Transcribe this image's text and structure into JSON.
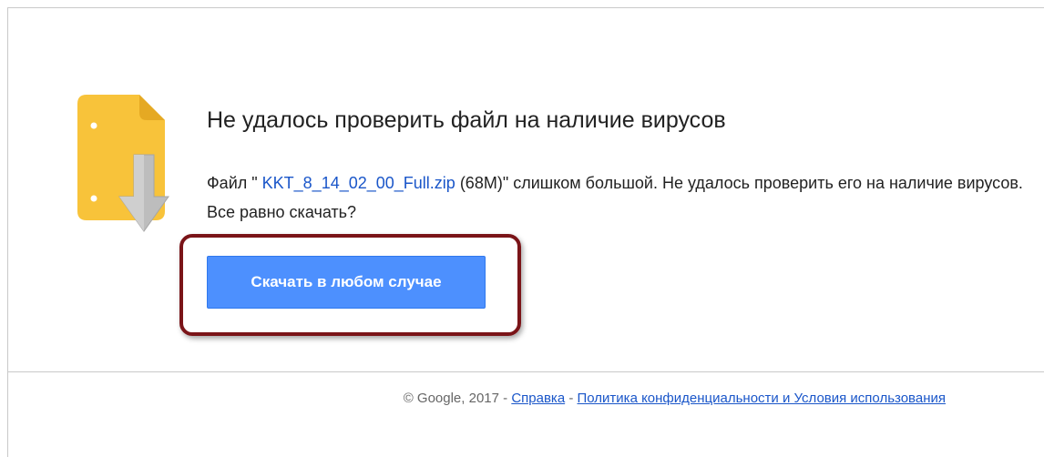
{
  "icon": {
    "name": "file-download-icon",
    "colors": {
      "file": "#f8c33a",
      "file_fold": "#e5a923",
      "arrow": "#b8b8b8"
    }
  },
  "warning": {
    "title": "Не удалось проверить файл на наличие вирусов",
    "message_prefix": "Файл \" ",
    "file_name": "KKT_8_14_02_00_Full.zip",
    "message_suffix": " (68M)\" слишком большой. Не удалось проверить его на наличие вирусов. Все равно скачать?"
  },
  "actions": {
    "download_label": "Скачать в любом случае"
  },
  "footer": {
    "copyright": "© Google, 2017 - ",
    "help_label": "Справка",
    "separator": " - ",
    "policy_label": "Политика конфиденциальности и Условия использования"
  },
  "colors": {
    "button_bg": "#4d90fe",
    "link": "#1a56c9",
    "highlight_border": "#7a1418"
  }
}
